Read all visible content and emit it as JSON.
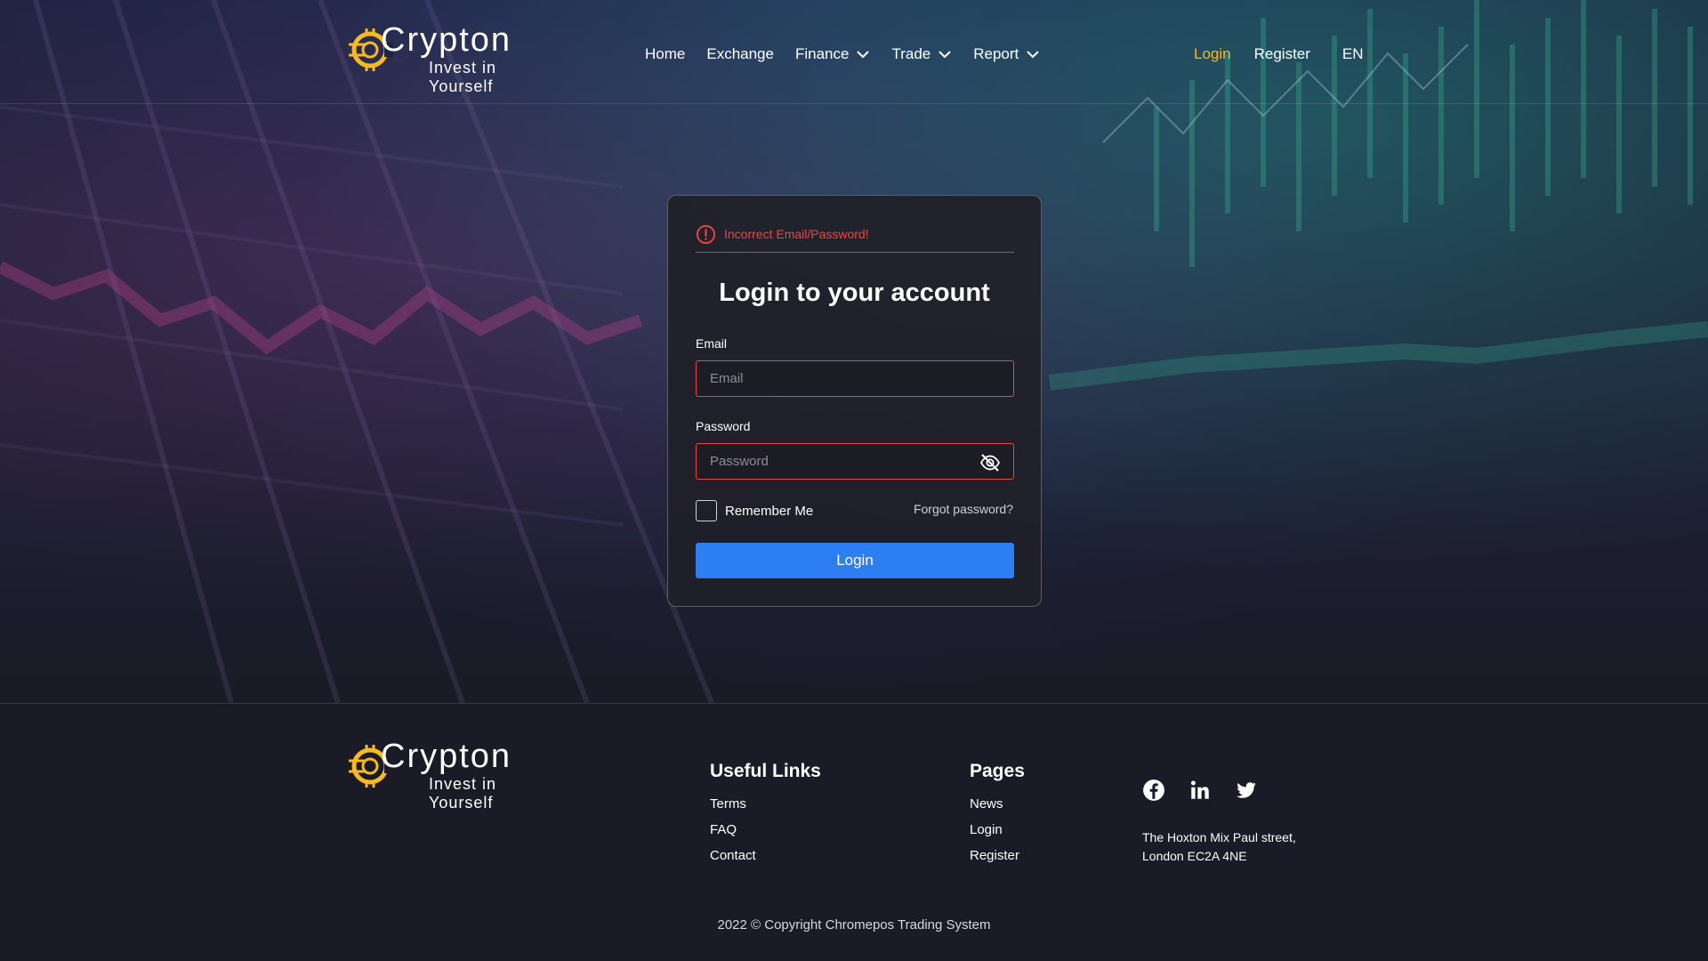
{
  "brand": {
    "name": "Crypton",
    "tagline": "Invest in Yourself",
    "accent_color": "#f7b924",
    "icon": "crypto-coin-logo-icon"
  },
  "nav": {
    "items": [
      {
        "label": "Home",
        "dropdown": false
      },
      {
        "label": "Exchange",
        "dropdown": false
      },
      {
        "label": "Finance",
        "dropdown": true
      },
      {
        "label": "Trade",
        "dropdown": true
      },
      {
        "label": "Report",
        "dropdown": true
      }
    ],
    "login": "Login",
    "register": "Register",
    "language": "EN",
    "active_color": "#f7b924"
  },
  "login_form": {
    "error_message": "Incorrect Email/Password!",
    "error_color": "#ef4444",
    "title": "Login to your account",
    "email_label": "Email",
    "email_placeholder": "Email",
    "email_value": "",
    "password_label": "Password",
    "password_placeholder": "Password",
    "password_value": "",
    "password_toggle_icon": "eye-off-icon",
    "remember_me": "Remember Me",
    "remember_checked": false,
    "forgot_password": "Forgot password?",
    "submit": "Login",
    "submit_color": "#2d7ef0"
  },
  "footer": {
    "useful_links_title": "Useful Links",
    "useful_links": [
      "Terms",
      "FAQ",
      "Contact"
    ],
    "pages_title": "Pages",
    "pages": [
      "News",
      "Login",
      "Register"
    ],
    "social_icons": [
      "facebook-icon",
      "linkedin-icon",
      "twitter-icon"
    ],
    "address_line1": "The Hoxton Mix Paul street,",
    "address_line2": "London EC2A 4NE",
    "copyright": "2022 © Copyright Chromepos Trading System"
  }
}
